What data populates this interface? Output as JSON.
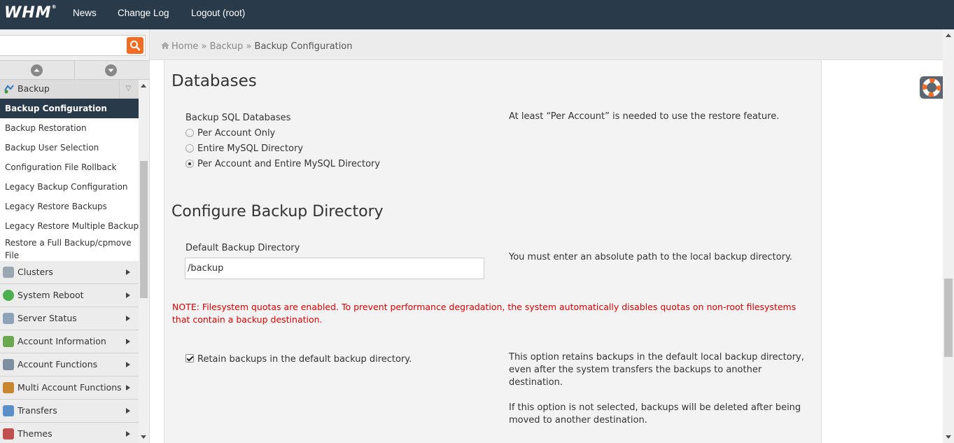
{
  "topbar": {
    "logo": "WHM",
    "nav": [
      "News",
      "Change Log",
      "Logout (root)"
    ]
  },
  "sidebar": {
    "search_value": "",
    "open_category": "Backup",
    "items": [
      "Backup Configuration",
      "Backup Restoration",
      "Backup User Selection",
      "Configuration File Rollback",
      "Legacy Backup Configuration",
      "Legacy Restore Backups",
      "Legacy Restore Multiple Backups",
      "Restore a Full Backup/cpmove File"
    ],
    "categories": [
      "Clusters",
      "System Reboot",
      "Server Status",
      "Account Information",
      "Account Functions",
      "Multi Account Functions",
      "Transfers",
      "Themes"
    ]
  },
  "breadcrumb": {
    "home": "Home",
    "sep": "»",
    "section": "Backup",
    "current": "Backup Configuration"
  },
  "databases": {
    "heading": "Databases",
    "label": "Backup SQL Databases",
    "options": [
      "Per Account Only",
      "Entire MySQL Directory",
      "Per Account and Entire MySQL Directory"
    ],
    "selected": "Per Account and Entire MySQL Directory",
    "help": "At least “Per Account” is needed to use the restore feature."
  },
  "directory": {
    "heading": "Configure Backup Directory",
    "label": "Default Backup Directory",
    "value": "/backup",
    "help": "You must enter an absolute path to the local backup directory.",
    "note": "NOTE: Filesystem quotas are enabled. To prevent performance degradation, the system automatically disables quotas on non-root filesystems that contain a backup destination.",
    "retain_label": "Retain backups in the default backup directory.",
    "retain_checked": true,
    "retain_help_1": "This option retains backups in the default local backup directory, even after the system transfers the backups to another destination.",
    "retain_help_2": "If this option is not selected, backups will be deleted after being moved to another destination."
  },
  "colors": {
    "topbar": "#293a4a",
    "accent": "#f26c23",
    "note": "#d40000"
  }
}
